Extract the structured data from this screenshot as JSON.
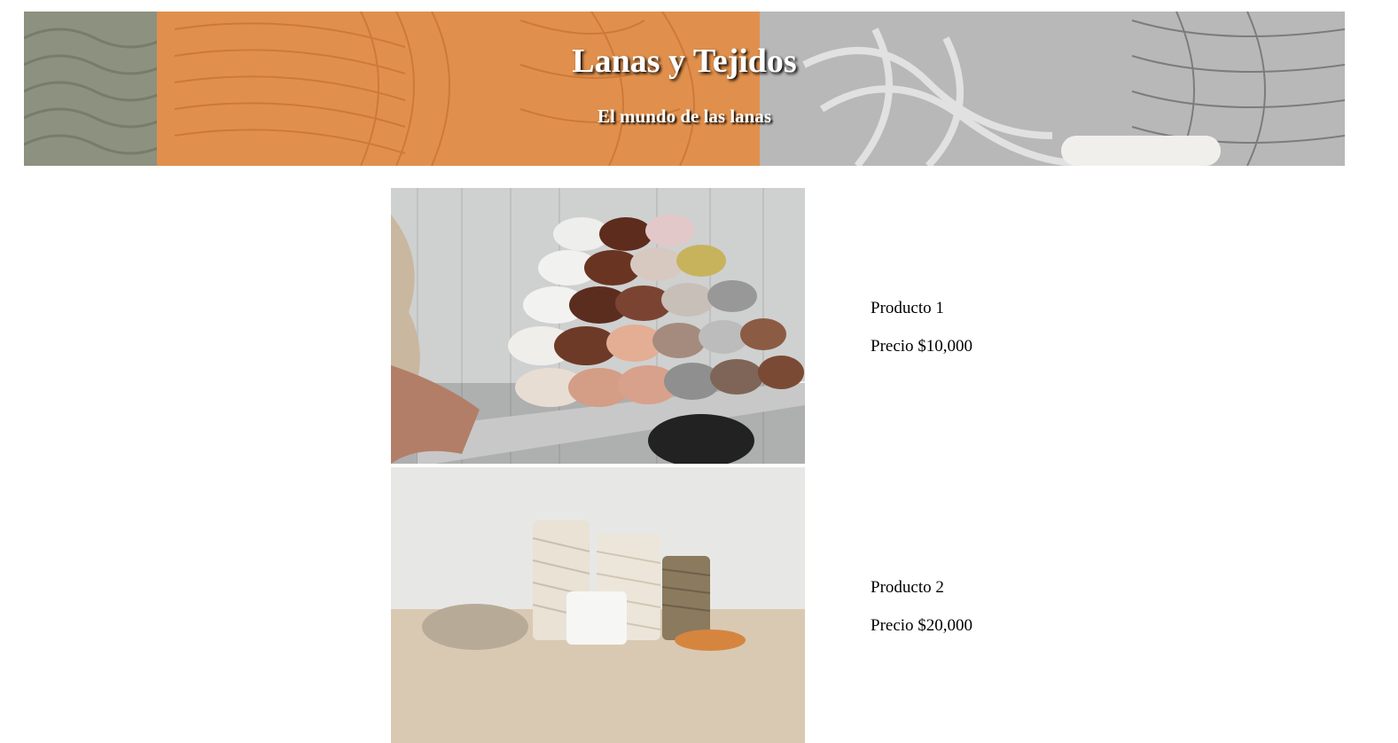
{
  "header": {
    "title": "Lanas y Tejidos",
    "subtitle": "El mundo de las lanas"
  },
  "products": [
    {
      "name": "Producto 1",
      "price": "Precio $10,000",
      "image": "yarn-skeins-on-shelf"
    },
    {
      "name": "Producto 2",
      "price": "Precio $20,000",
      "image": "cotton-cord-spools"
    }
  ]
}
